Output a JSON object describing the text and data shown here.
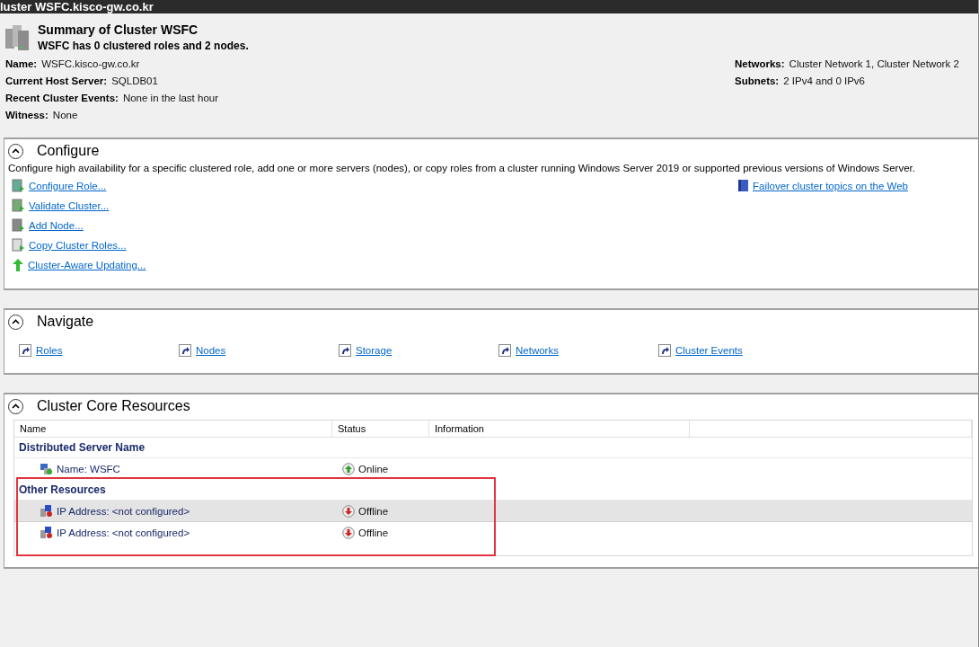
{
  "window": {
    "title": "luster WSFC.kisco-gw.co.kr"
  },
  "summary": {
    "heading": "Summary of Cluster WSFC",
    "subheading": "WSFC has 0 clustered roles and 2 nodes.",
    "left_fields": [
      {
        "label": "Name:",
        "value": "WSFC.kisco-gw.co.kr"
      },
      {
        "label": "Current Host Server:",
        "value": "SQLDB01"
      },
      {
        "label": "Recent Cluster Events:",
        "value": "None in the last hour"
      },
      {
        "label": "Witness:",
        "value": "None"
      }
    ],
    "right_fields": [
      {
        "label": "Networks:",
        "value": "Cluster Network 1, Cluster Network 2"
      },
      {
        "label": "Subnets:",
        "value": "2 IPv4 and 0 IPv6"
      }
    ]
  },
  "configure": {
    "title": "Configure",
    "expanded": true,
    "description": "Configure high availability for a specific clustered role, add one or more servers (nodes), or copy roles from a cluster running Windows Server 2019 or supported previous versions of Windows Server.",
    "actions": [
      {
        "kind": "role",
        "label": "Configure Role..."
      },
      {
        "kind": "validate",
        "label": "Validate Cluster..."
      },
      {
        "kind": "node",
        "label": "Add Node..."
      },
      {
        "kind": "copy",
        "label": "Copy Cluster Roles..."
      },
      {
        "kind": "update",
        "label": "Cluster-Aware Updating..."
      }
    ],
    "help_link": "Failover cluster topics on the Web"
  },
  "navigate": {
    "title": "Navigate",
    "expanded": true,
    "links": [
      "Roles",
      "Nodes",
      "Storage",
      "Networks",
      "Cluster Events"
    ]
  },
  "core_resources": {
    "title": "Cluster Core Resources",
    "expanded": true,
    "columns": [
      "Name",
      "Status",
      "Information"
    ],
    "groups": [
      {
        "name": "Distributed Server Name",
        "rows": [
          {
            "kind": "name",
            "name": "Name: WSFC",
            "status": "Online",
            "online": true,
            "selected": false
          }
        ]
      },
      {
        "name": "Other Resources",
        "rows": [
          {
            "kind": "ip",
            "name": "IP Address: <not configured>",
            "status": "Offline",
            "online": false,
            "selected": true
          },
          {
            "kind": "ip",
            "name": "IP Address: <not configured>",
            "status": "Offline",
            "online": false,
            "selected": false
          }
        ]
      }
    ]
  }
}
